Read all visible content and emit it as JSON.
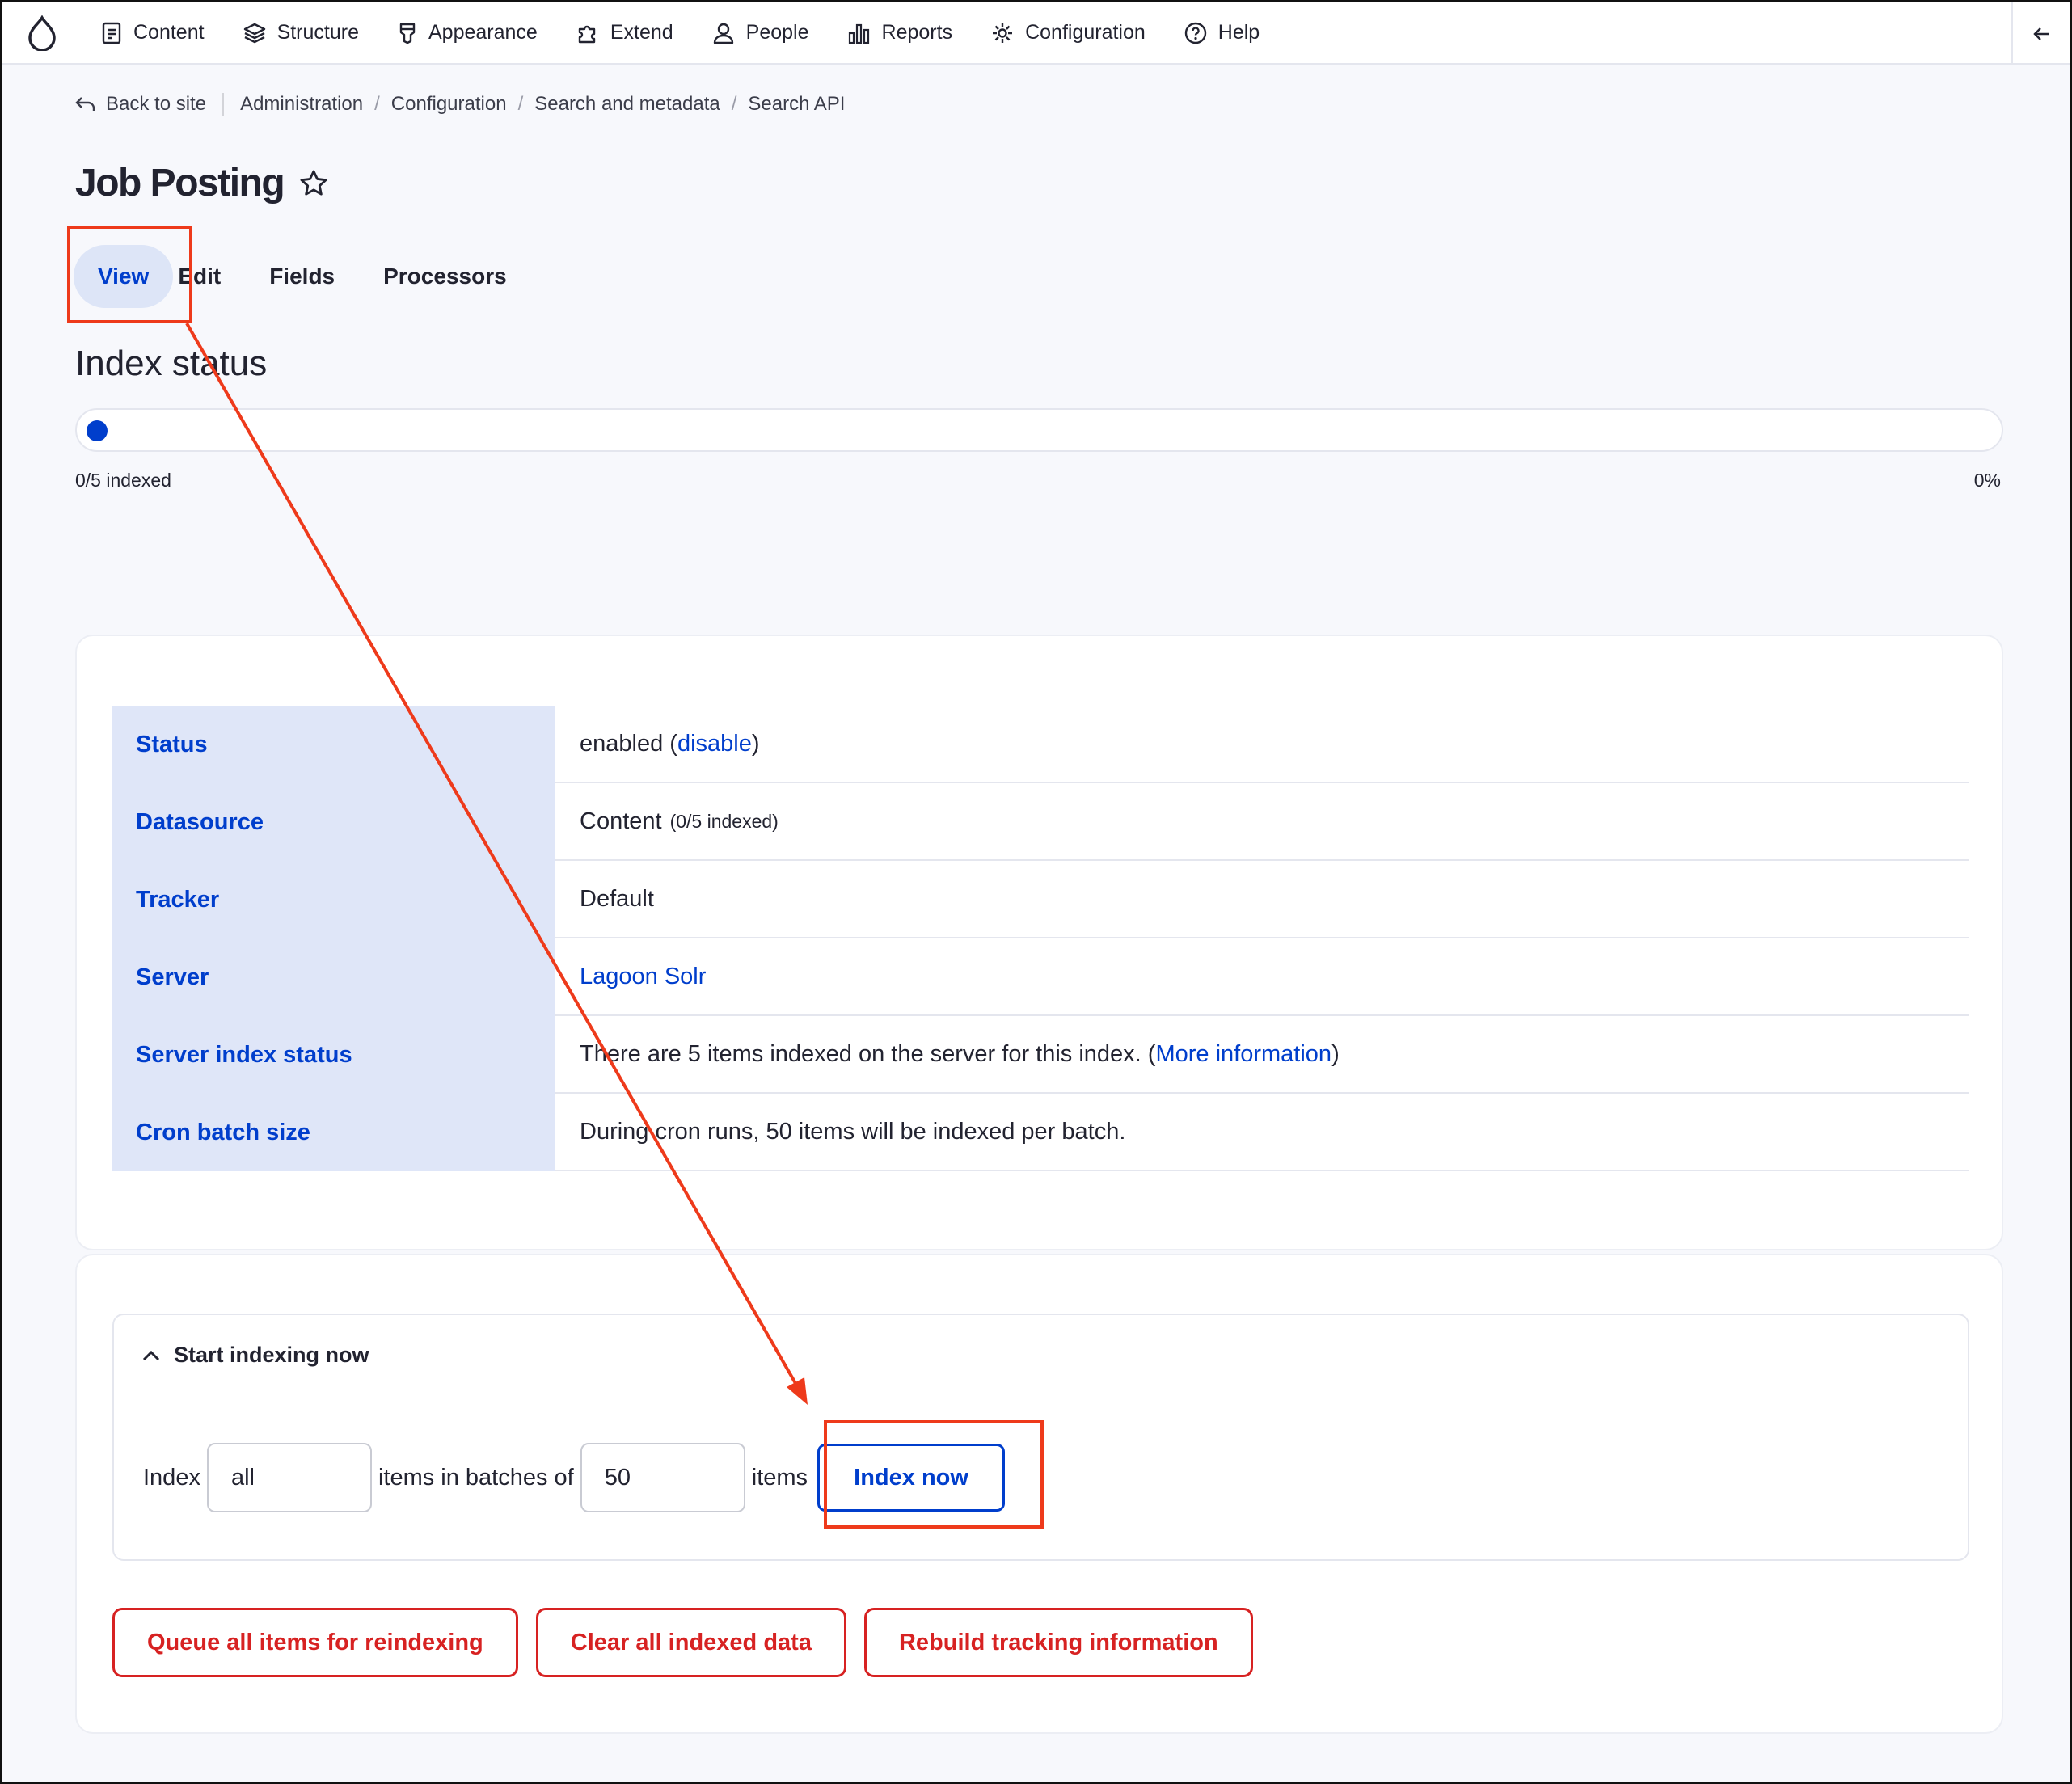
{
  "toolbar": {
    "items": [
      {
        "label": "Content",
        "icon": "document-icon"
      },
      {
        "label": "Structure",
        "icon": "layers-icon"
      },
      {
        "label": "Appearance",
        "icon": "brush-icon"
      },
      {
        "label": "Extend",
        "icon": "puzzle-icon"
      },
      {
        "label": "People",
        "icon": "person-icon"
      },
      {
        "label": "Reports",
        "icon": "bar-chart-icon"
      },
      {
        "label": "Configuration",
        "icon": "gear-icon"
      },
      {
        "label": "Help",
        "icon": "help-icon"
      }
    ]
  },
  "breadcrumb": {
    "back": "Back to site",
    "items": [
      "Administration",
      "Configuration",
      "Search and metadata",
      "Search API"
    ]
  },
  "page": {
    "title": "Job Posting",
    "tabs": [
      "View",
      "Edit",
      "Fields",
      "Processors"
    ],
    "active_tab": "View"
  },
  "index_status": {
    "heading": "Index status",
    "label": "0/5 indexed",
    "percent_text": "0%",
    "progress_fraction": 0
  },
  "details_table": {
    "status": {
      "key": "Status",
      "text": "enabled (",
      "link": "disable",
      "suffix": ")"
    },
    "datasource": {
      "key": "Datasource",
      "text": "Content",
      "note": "(0/5 indexed)"
    },
    "tracker": {
      "key": "Tracker",
      "text": "Default"
    },
    "server": {
      "key": "Server",
      "link": "Lagoon Solr"
    },
    "server_index_status": {
      "key": "Server index status",
      "text": "There are 5 items indexed on the server for this index. (",
      "link": "More information",
      "suffix": ")"
    },
    "cron_batch_size": {
      "key": "Cron batch size",
      "text": "During cron runs, 50 items will be indexed per batch."
    }
  },
  "indexing": {
    "summary": "Start indexing now",
    "label_index": "Index",
    "items_value": "all",
    "label_batches": "items in batches of",
    "batch_value": "50",
    "label_items": "items",
    "button": "Index now"
  },
  "actions": {
    "queue": "Queue all items for reindexing",
    "clear": "Clear all indexed data",
    "rebuild": "Rebuild tracking information"
  },
  "colors": {
    "accent": "#003ecc",
    "danger": "#d72222",
    "annotation": "#ee3a1b",
    "table_key_bg": "#dfe6f8"
  }
}
